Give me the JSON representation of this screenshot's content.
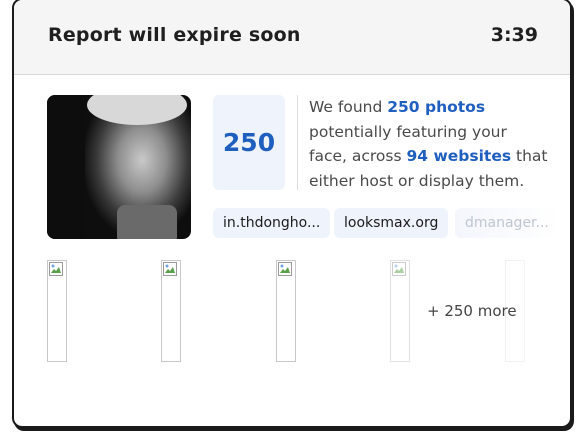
{
  "header": {
    "title": "Report will expire soon",
    "timer": "3:39"
  },
  "summary": {
    "count": "250",
    "text_1": "We found ",
    "photos_link": "250 photos",
    "text_2": " potentially featuring your face, across ",
    "websites_link": "94 websites",
    "text_3": " that either host or display them."
  },
  "chips": [
    {
      "label": "in.thdongho..."
    },
    {
      "label": "looksmax.org"
    },
    {
      "label": "dmanager..."
    }
  ],
  "photos": {
    "more_label": "+ 250 more"
  }
}
